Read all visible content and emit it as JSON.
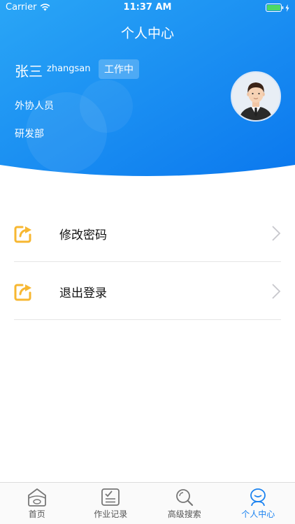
{
  "status_bar": {
    "carrier": "Carrier",
    "time": "11:37 AM"
  },
  "header": {
    "title": "个人中心"
  },
  "profile": {
    "name": "张三",
    "account": "zhangsan",
    "status": "工作中",
    "role": "外协人员",
    "department": "研发部"
  },
  "menu": {
    "items": [
      {
        "label": "修改密码",
        "icon": "edit-icon"
      },
      {
        "label": "退出登录",
        "icon": "edit-icon"
      }
    ]
  },
  "tabbar": {
    "tabs": [
      {
        "label": "首页",
        "icon": "home-icon"
      },
      {
        "label": "作业记录",
        "icon": "checklist-icon"
      },
      {
        "label": "高级搜索",
        "icon": "search-icon"
      },
      {
        "label": "个人中心",
        "icon": "person-icon",
        "active": true
      }
    ]
  },
  "colors": {
    "header_start": "#2aa6f6",
    "header_end": "#0b78ee",
    "accent": "#1a82f0",
    "menu_icon": "#f7b731"
  }
}
